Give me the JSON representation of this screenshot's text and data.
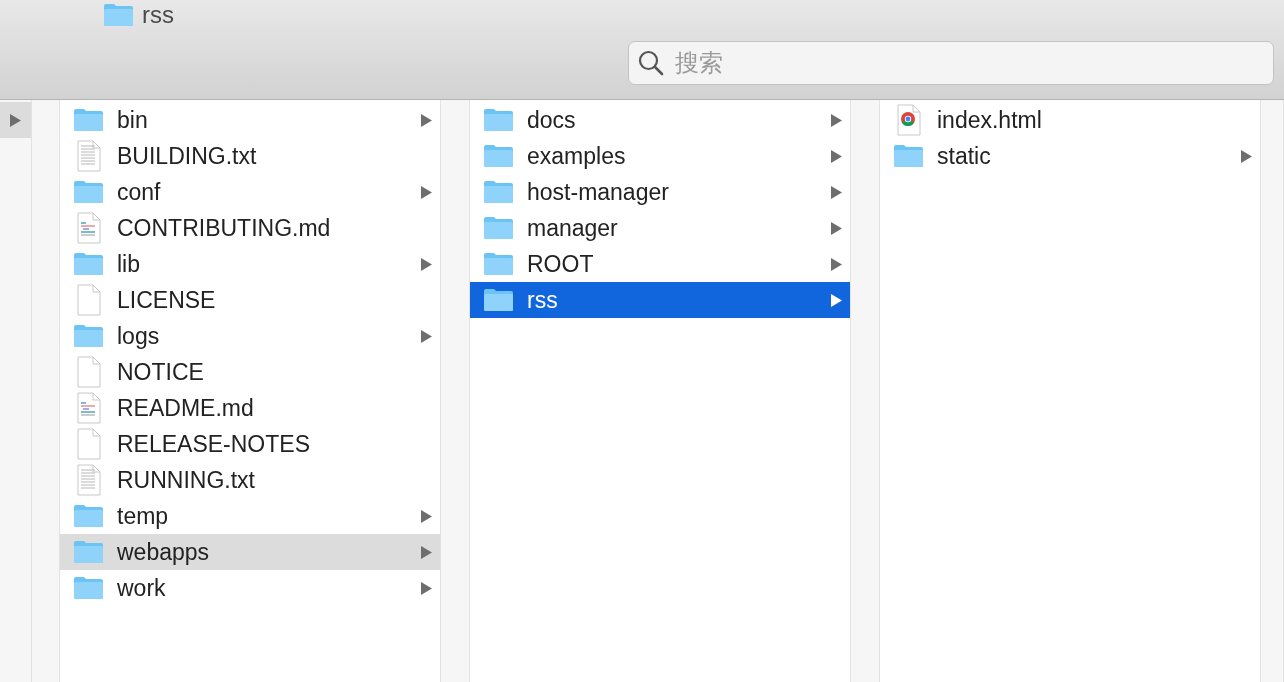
{
  "window": {
    "title": "rss"
  },
  "search": {
    "placeholder": "搜索"
  },
  "parent_column": {
    "row_selected": true
  },
  "columns": [
    {
      "focused": false,
      "items": [
        {
          "name": "bin",
          "kind": "folder",
          "selected": false
        },
        {
          "name": "BUILDING.txt",
          "kind": "text",
          "selected": false
        },
        {
          "name": "conf",
          "kind": "folder",
          "selected": false
        },
        {
          "name": "CONTRIBUTING.md",
          "kind": "markdown",
          "selected": false
        },
        {
          "name": "lib",
          "kind": "folder",
          "selected": false
        },
        {
          "name": "LICENSE",
          "kind": "blank",
          "selected": false
        },
        {
          "name": "logs",
          "kind": "folder",
          "selected": false
        },
        {
          "name": "NOTICE",
          "kind": "blank",
          "selected": false
        },
        {
          "name": "README.md",
          "kind": "markdown",
          "selected": false
        },
        {
          "name": "RELEASE-NOTES",
          "kind": "blank",
          "selected": false
        },
        {
          "name": "RUNNING.txt",
          "kind": "text",
          "selected": false
        },
        {
          "name": "temp",
          "kind": "folder",
          "selected": false
        },
        {
          "name": "webapps",
          "kind": "folder",
          "selected": true
        },
        {
          "name": "work",
          "kind": "folder",
          "selected": false
        }
      ]
    },
    {
      "focused": true,
      "items": [
        {
          "name": "docs",
          "kind": "folder",
          "selected": false
        },
        {
          "name": "examples",
          "kind": "folder",
          "selected": false
        },
        {
          "name": "host-manager",
          "kind": "folder",
          "selected": false
        },
        {
          "name": "manager",
          "kind": "folder",
          "selected": false
        },
        {
          "name": "ROOT",
          "kind": "folder",
          "selected": false
        },
        {
          "name": "rss",
          "kind": "folder",
          "selected": true
        }
      ]
    },
    {
      "items": [
        {
          "name": "index.html",
          "kind": "html",
          "selected": false
        },
        {
          "name": "static",
          "kind": "folder",
          "selected": false
        }
      ]
    }
  ]
}
